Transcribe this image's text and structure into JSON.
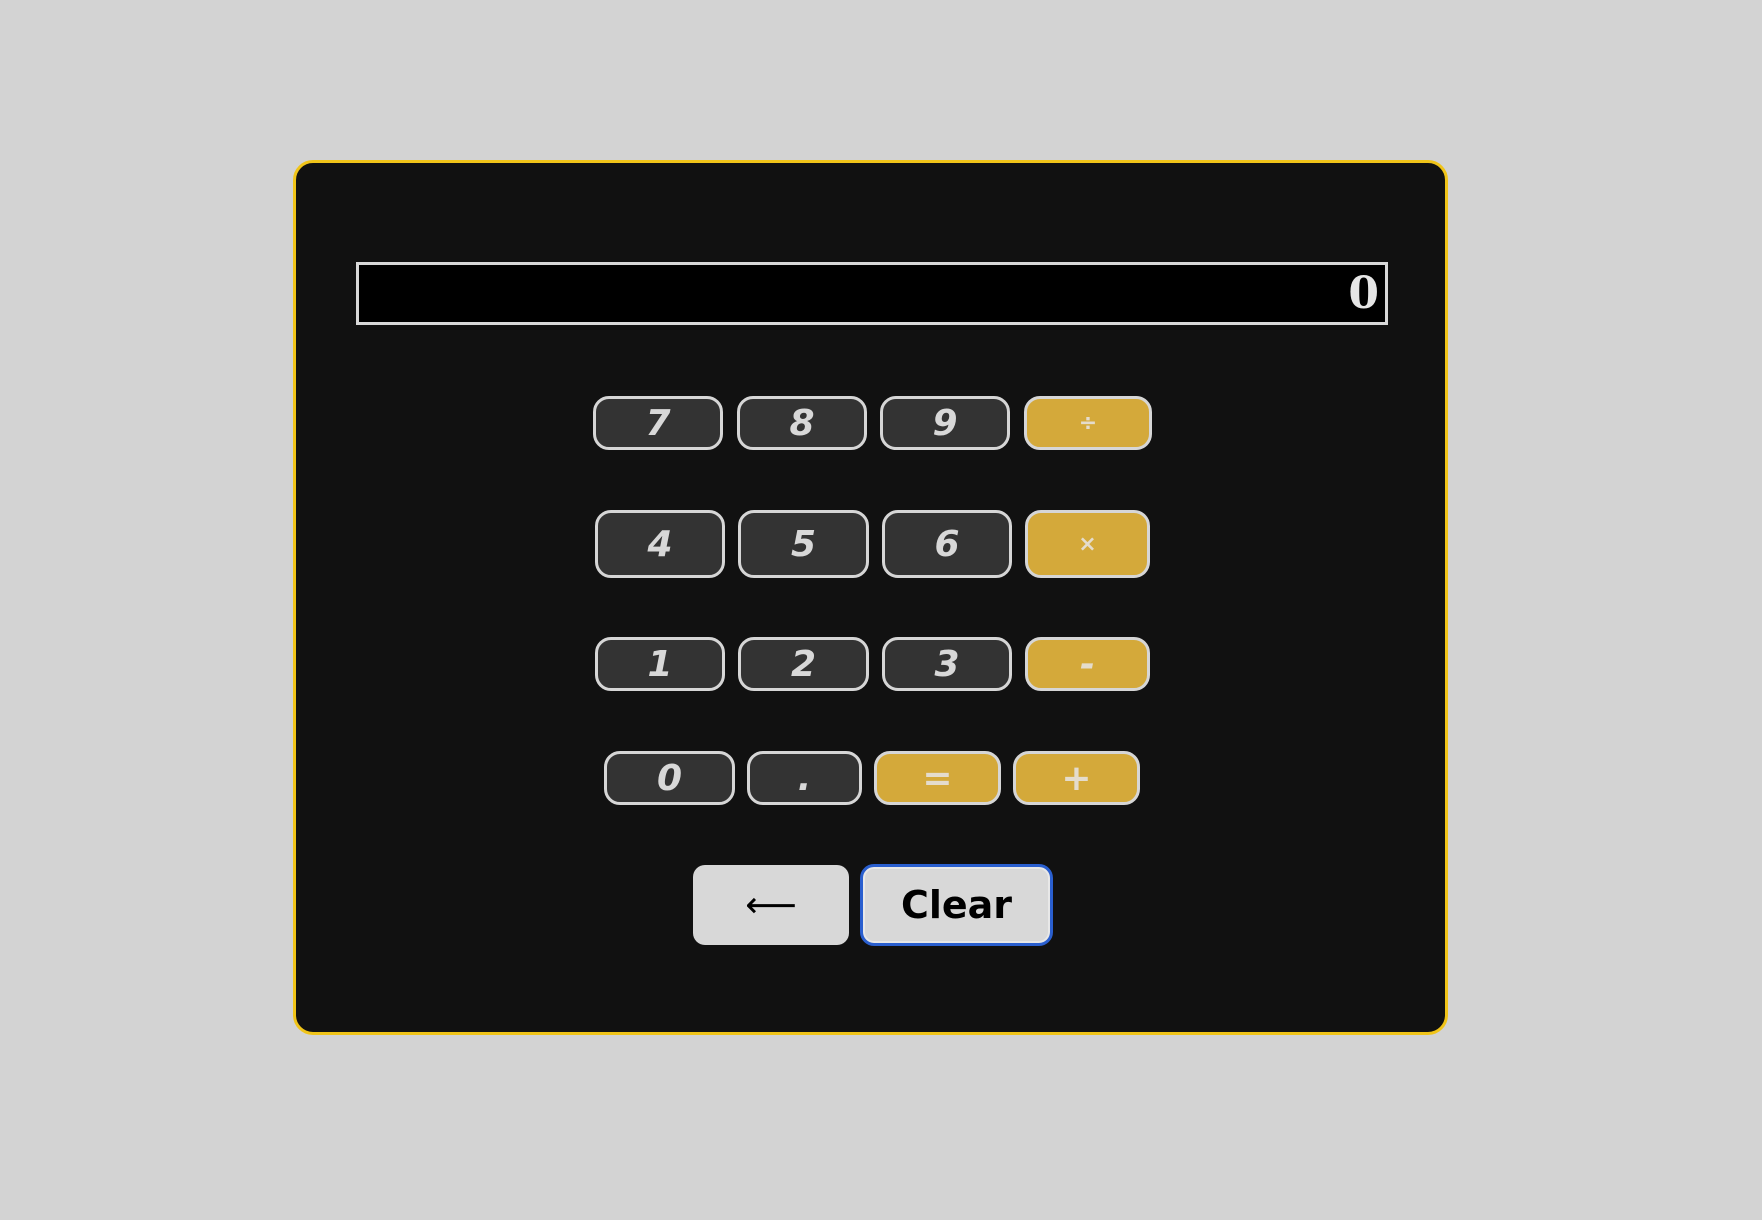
{
  "display": {
    "value": "0"
  },
  "keypad": {
    "row1": [
      "7",
      "8",
      "9",
      "÷"
    ],
    "row2": [
      "4",
      "5",
      "6",
      "×"
    ],
    "row3": [
      "1",
      "2",
      "3",
      "-"
    ],
    "row4": [
      "0",
      ".",
      "=",
      "+"
    ]
  },
  "controls": {
    "backspace_label": "⟵",
    "clear_label": "Clear"
  },
  "colors": {
    "page_background": "#d3d3d3",
    "panel_background": "#111111",
    "panel_border": "#f0c419",
    "number_key": "#333333",
    "operator_key": "#d4a93a",
    "focus_ring": "#2a5fcf"
  }
}
